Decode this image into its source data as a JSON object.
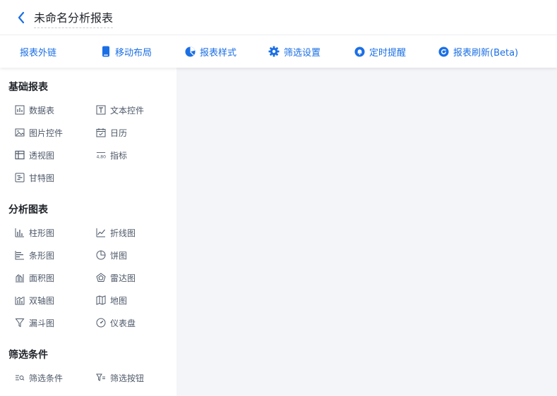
{
  "header": {
    "title": "未命名分析报表"
  },
  "toolbar": {
    "items": [
      {
        "label": "报表外链",
        "icon": "none"
      },
      {
        "label": "移动布局",
        "icon": "mobile-icon"
      },
      {
        "label": "报表样式",
        "icon": "pie-style-icon"
      },
      {
        "label": "筛选设置",
        "icon": "gear-icon"
      },
      {
        "label": "定时提醒",
        "icon": "bell-icon"
      },
      {
        "label": "报表刷新(Beta)",
        "icon": "refresh-icon"
      }
    ]
  },
  "sidebar": {
    "sections": [
      {
        "title": "基础报表",
        "items": [
          {
            "label": "数据表",
            "icon": "data-table-icon"
          },
          {
            "label": "文本控件",
            "icon": "text-control-icon"
          },
          {
            "label": "图片控件",
            "icon": "image-control-icon"
          },
          {
            "label": "日历",
            "icon": "calendar-icon"
          },
          {
            "label": "透视图",
            "icon": "pivot-icon"
          },
          {
            "label": "指标",
            "icon": "metric-icon"
          },
          {
            "label": "甘特图",
            "icon": "gantt-icon"
          }
        ]
      },
      {
        "title": "分析图表",
        "items": [
          {
            "label": "柱形图",
            "icon": "column-chart-icon"
          },
          {
            "label": "折线图",
            "icon": "line-chart-icon"
          },
          {
            "label": "条形图",
            "icon": "bar-chart-icon"
          },
          {
            "label": "饼图",
            "icon": "pie-chart-icon"
          },
          {
            "label": "面积图",
            "icon": "area-chart-icon"
          },
          {
            "label": "雷达图",
            "icon": "radar-chart-icon"
          },
          {
            "label": "双轴图",
            "icon": "dual-axis-icon"
          },
          {
            "label": "地图",
            "icon": "map-icon"
          },
          {
            "label": "漏斗图",
            "icon": "funnel-icon"
          },
          {
            "label": "仪表盘",
            "icon": "gauge-icon"
          }
        ]
      },
      {
        "title": "筛选条件",
        "items": [
          {
            "label": "筛选条件",
            "icon": "filter-condition-icon"
          },
          {
            "label": "筛选按钮",
            "icon": "filter-button-icon"
          }
        ]
      }
    ]
  },
  "colors": {
    "accent": "#1b6fe5",
    "canvas": "#f4f5f8",
    "text": "#1f2329",
    "muted": "#4e5969"
  }
}
